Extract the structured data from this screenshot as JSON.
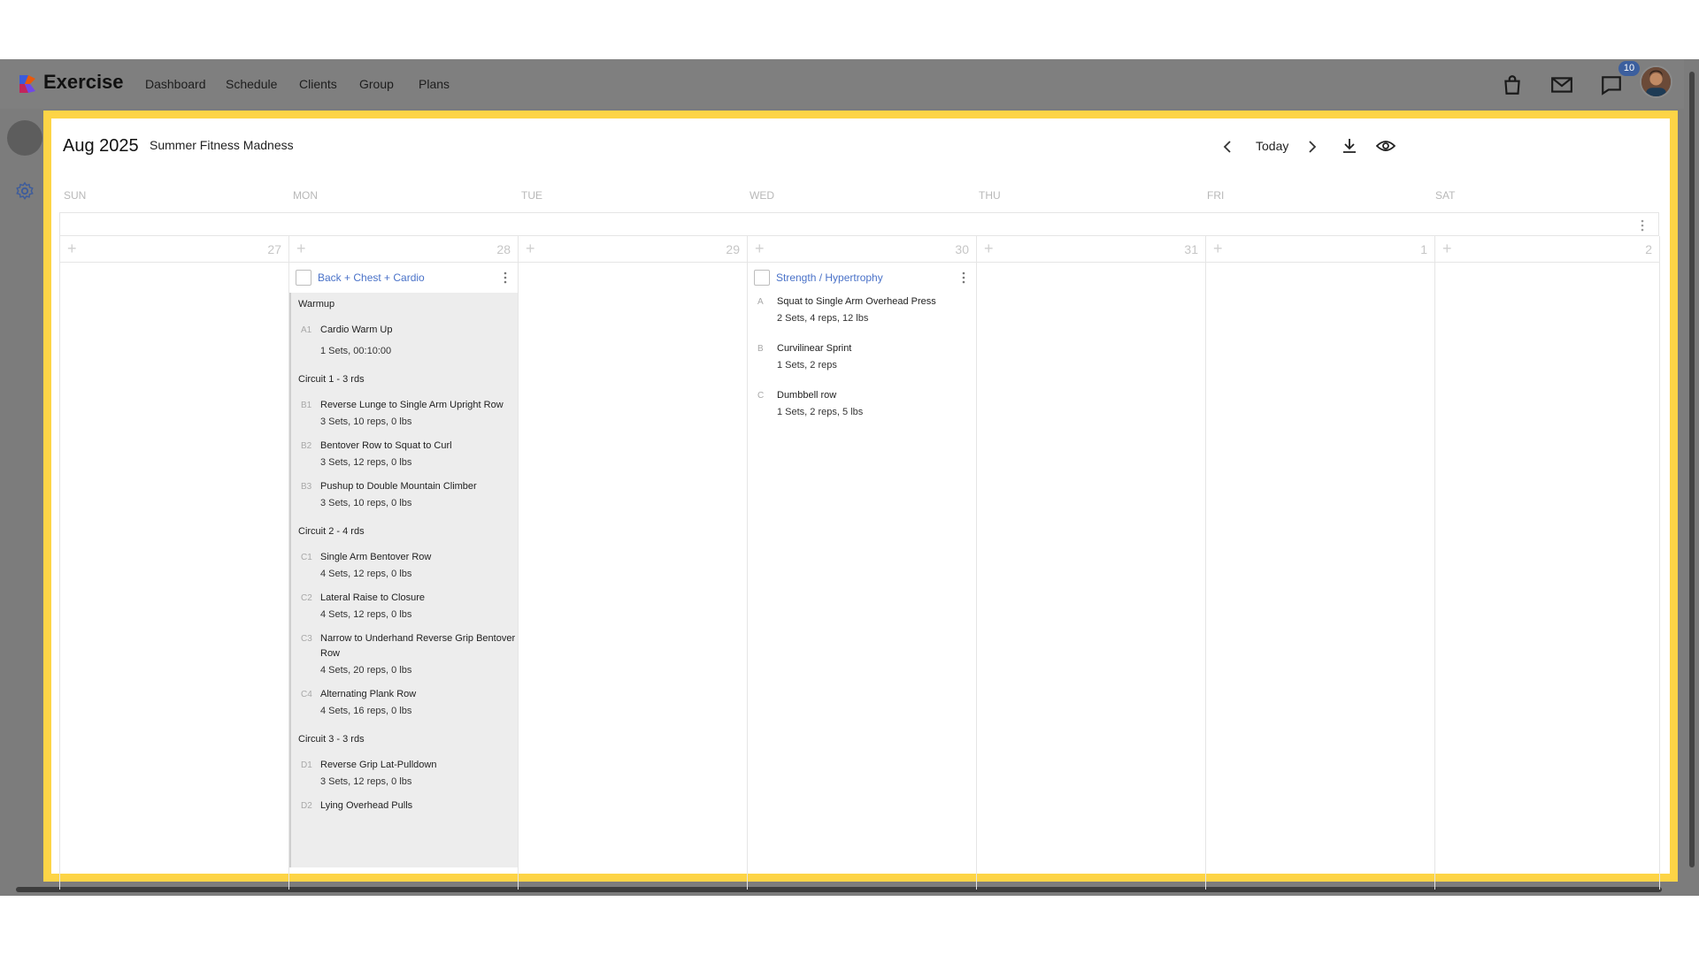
{
  "app": {
    "name": "Exercise"
  },
  "nav": [
    "Dashboard",
    "Schedule",
    "Clients",
    "Group",
    "Plans"
  ],
  "notifications": {
    "count": "10"
  },
  "calendar": {
    "month_title": "Aug 2025",
    "plan_name": "Summer Fitness Madness",
    "today_label": "Today",
    "weekdays": [
      "SUN",
      "MON",
      "TUE",
      "WED",
      "THU",
      "FRI",
      "SAT"
    ],
    "day_numbers": [
      "27",
      "28",
      "29",
      "30",
      "31",
      "1",
      "2"
    ]
  },
  "workouts": {
    "mon": {
      "title": "Back + Chest + Cardio",
      "sections": [
        {
          "title": "Warmup",
          "exercises": [
            {
              "code": "A1",
              "name": "Cardio Warm Up",
              "detail": "1 Sets, 00:10:00"
            }
          ]
        },
        {
          "title": "Circuit 1 - 3 rds",
          "exercises": [
            {
              "code": "B1",
              "name": "Reverse Lunge to Single Arm Upright Row",
              "detail": "3 Sets, 10 reps, 0 lbs"
            },
            {
              "code": "B2",
              "name": "Bentover Row to Squat to Curl",
              "detail": "3 Sets, 12 reps, 0 lbs"
            },
            {
              "code": "B3",
              "name": "Pushup to Double Mountain Climber",
              "detail": "3 Sets, 10 reps, 0 lbs"
            }
          ]
        },
        {
          "title": "Circuit 2 - 4 rds",
          "exercises": [
            {
              "code": "C1",
              "name": "Single Arm Bentover Row",
              "detail": "4 Sets, 12 reps, 0 lbs"
            },
            {
              "code": "C2",
              "name": "Lateral Raise to Closure",
              "detail": "4 Sets, 12 reps, 0 lbs"
            },
            {
              "code": "C3",
              "name": "Narrow to Underhand Reverse Grip Bentover Row",
              "detail": "4 Sets, 20 reps, 0 lbs"
            },
            {
              "code": "C4",
              "name": "Alternating Plank Row",
              "detail": "4 Sets, 16 reps, 0 lbs"
            }
          ]
        },
        {
          "title": "Circuit 3 - 3 rds",
          "exercises": [
            {
              "code": "D1",
              "name": "Reverse Grip Lat-Pulldown",
              "detail": "3 Sets, 12 reps, 0 lbs"
            },
            {
              "code": "D2",
              "name": "Lying Overhead Pulls",
              "detail": ""
            }
          ]
        }
      ]
    },
    "wed": {
      "title": "Strength / Hypertrophy",
      "exercises": [
        {
          "code": "A",
          "name": "Squat to Single Arm Overhead Press",
          "detail": "2 Sets, 4 reps, 12 lbs"
        },
        {
          "code": "B",
          "name": "Curvilinear Sprint",
          "detail": "1 Sets, 2 reps"
        },
        {
          "code": "C",
          "name": "Dumbbell row",
          "detail": "1 Sets, 2 reps, 5 lbs"
        }
      ]
    }
  },
  "colors": {
    "highlight_border": "#fdd446",
    "link": "#4a72c8",
    "badge": "#3c5f9e"
  }
}
